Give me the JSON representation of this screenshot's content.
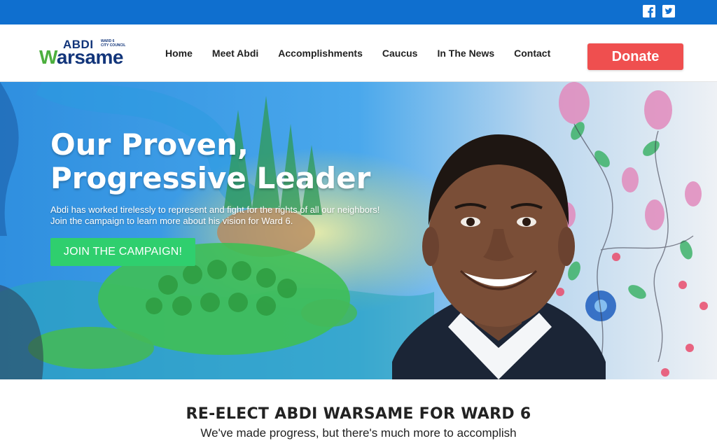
{
  "social": {
    "facebook_icon": "facebook-icon",
    "twitter_icon": "twitter-icon",
    "bar_color": "#0f6fcf"
  },
  "logo": {
    "first": "ABDI",
    "ward_line1": "WARD 6",
    "ward_line2": "CITY COUNCIL",
    "last_w": "W",
    "last_rest": "arsame"
  },
  "nav": {
    "items": [
      {
        "label": "Home"
      },
      {
        "label": "Meet Abdi"
      },
      {
        "label": "Accomplishments"
      },
      {
        "label": "Caucus"
      },
      {
        "label": "In The News"
      },
      {
        "label": "Contact"
      }
    ],
    "donate_label": "Donate",
    "donate_color": "#ef4f4f"
  },
  "hero": {
    "title_line1": "Our Proven,",
    "title_line2": "Progressive Leader",
    "subtitle_line1": "Abdi has worked tirelessly to represent and fight for the rights of all our neighbors!",
    "subtitle_line2": "Join the campaign to learn more about his vision for Ward 6.",
    "cta_label": "JOIN THE CAMPAIGN!",
    "cta_color": "#2fcf6e"
  },
  "section": {
    "title": "RE-ELECT ABDI WARSAME FOR WARD 6",
    "subtitle": "We've made progress, but there's much more to accomplish"
  }
}
